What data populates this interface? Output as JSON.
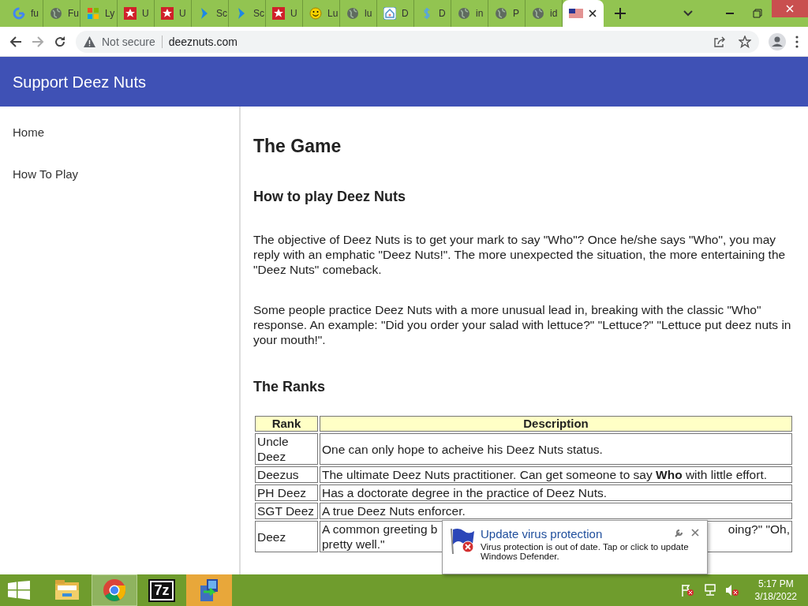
{
  "browser": {
    "tabs": [
      {
        "kind": "google",
        "label": "fu",
        "selected": false
      },
      {
        "kind": "globe",
        "label": "Fu",
        "selected": false
      },
      {
        "kind": "squares",
        "label": "Ly",
        "selected": false
      },
      {
        "kind": "star",
        "label": "U",
        "selected": false
      },
      {
        "kind": "star",
        "label": "U",
        "selected": false
      },
      {
        "kind": "chevron",
        "label": "Sc",
        "selected": false
      },
      {
        "kind": "chevron",
        "label": "Sc",
        "selected": false
      },
      {
        "kind": "star",
        "label": "U",
        "selected": false
      },
      {
        "kind": "smiley",
        "label": "Lu",
        "selected": false
      },
      {
        "kind": "globe",
        "label": "lu",
        "selected": false
      },
      {
        "kind": "house",
        "label": "D",
        "selected": false
      },
      {
        "kind": "dollar",
        "label": "D",
        "selected": false
      },
      {
        "kind": "globe",
        "label": "in",
        "selected": false
      },
      {
        "kind": "globe",
        "label": "P",
        "selected": false
      },
      {
        "kind": "globe",
        "label": "id",
        "selected": false
      },
      {
        "kind": "flag",
        "selected": true
      }
    ],
    "security": "Not secure",
    "url": "deeznuts.com"
  },
  "header": {
    "title": "Support Deez Nuts"
  },
  "sidebar": {
    "items": [
      {
        "label": "Home"
      },
      {
        "label": "How To Play"
      }
    ]
  },
  "content": {
    "title": "The Game",
    "sections": [
      {
        "heading": "How to play Deez Nuts",
        "paragraphs": [
          "The objective of Deez Nuts is to get your mark to say \"Who\"? Once he/she says \"Who\", you may reply with an emphatic \"Deez Nuts!\". The more unexpected the situation, the more entertaining the \"Deez Nuts\" comeback.",
          "Some people practice Deez Nuts with a more unusual lead in, breaking with the classic \"Who\" response. An example: \"Did you order your salad with lettuce?\" \"Lettuce?\" \"Lettuce put deez nuts in your mouth!\"."
        ]
      },
      {
        "heading": "The Ranks"
      }
    ],
    "table": {
      "columns": [
        "Rank",
        "Description"
      ],
      "rows": [
        {
          "rank": "Uncle Deez",
          "description": "One can only hope to acheive his Deez Nuts status."
        },
        {
          "rank": "Deezus",
          "description": "The ultimate Deez Nuts practitioner. Can get someone to say **Who** with little effort."
        },
        {
          "rank": "PH Deez",
          "description": "Has a doctorate degree in the practice of Deez Nuts."
        },
        {
          "rank": "SGT Deez",
          "description": "A true Deez Nuts enforcer."
        },
        {
          "rank": "Deez",
          "description_lines": [
            [
              "A common greeting b",
              "oing?\" \"Oh,"
            ],
            [
              "pretty well.\""
            ]
          ]
        }
      ]
    }
  },
  "notification": {
    "title": "Update virus protection",
    "message": "Virus protection is out of date. Tap or click to update Windows Defender."
  },
  "taskbar": {
    "apps": [
      {
        "kind": "explorer",
        "selected": false
      },
      {
        "kind": "chrome",
        "selected": true
      },
      {
        "kind": "archiver",
        "label": "7z",
        "selected": false
      },
      {
        "kind": "installer",
        "selected": false
      }
    ],
    "time": "5:17 PM",
    "date": "3/18/2022"
  }
}
